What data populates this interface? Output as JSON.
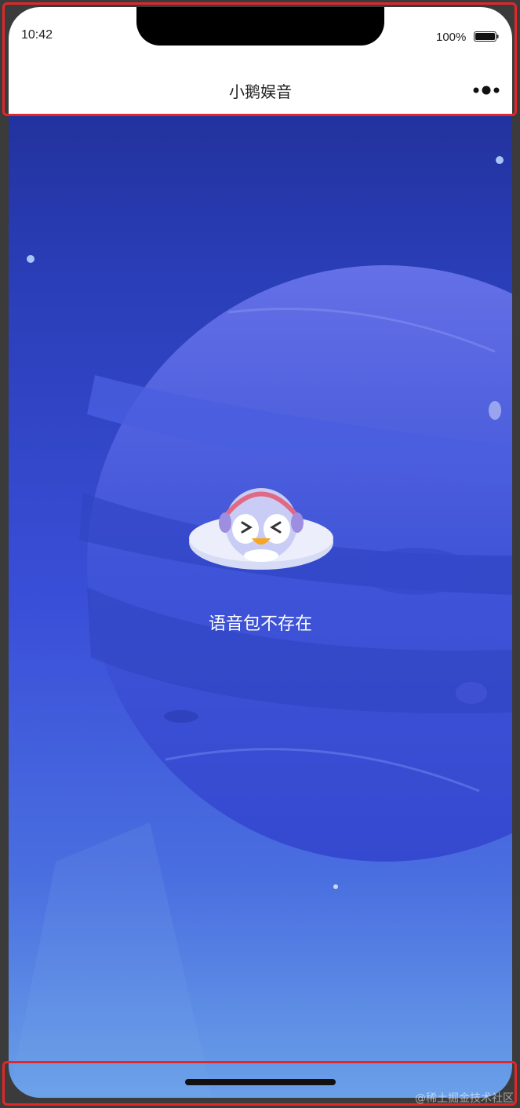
{
  "status_bar": {
    "time": "10:42",
    "battery": "100%"
  },
  "nav": {
    "title": "小鹅娱音",
    "more_icon": "more-dots-icon"
  },
  "empty_state": {
    "illustration": "penguin-ufo-icon",
    "message": "语音包不存在"
  },
  "watermark": "@稀土掘金技术社区",
  "colors": {
    "bg_top": "#1d2a8c",
    "bg_bottom": "#6aa0e8",
    "highlight": "#e0282a"
  }
}
